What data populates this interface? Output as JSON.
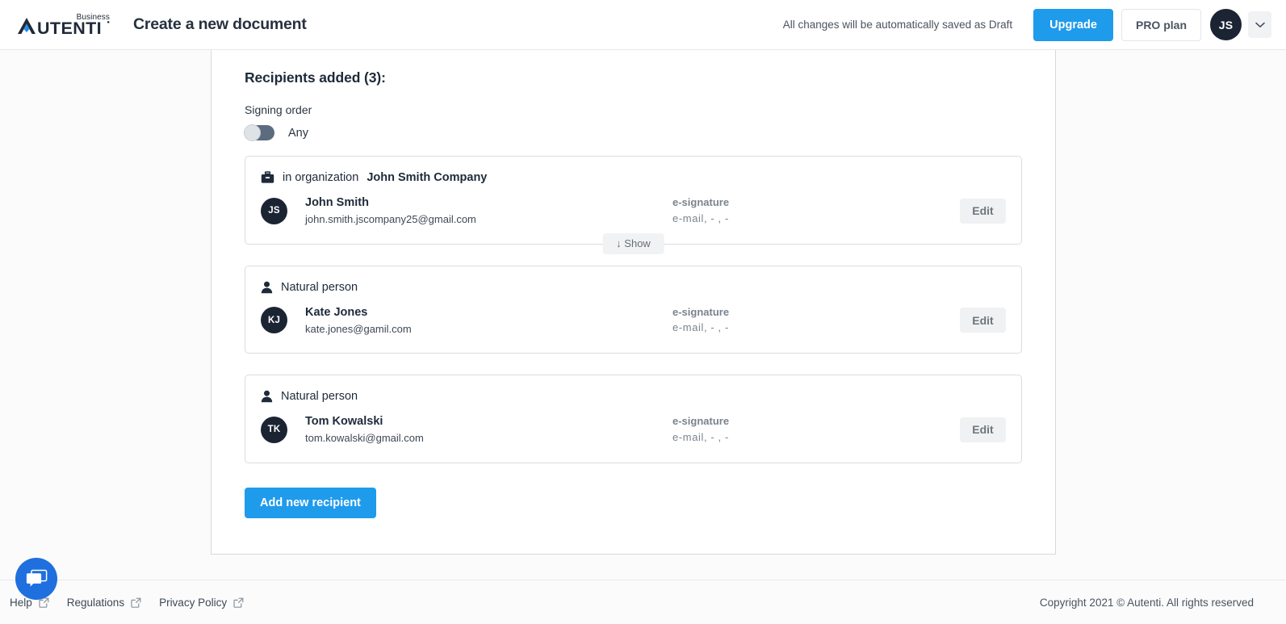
{
  "header": {
    "logo_text": "AUTENTI",
    "logo_super": "Business",
    "page_title": "Create a new document",
    "autosave_note": "All changes will be automatically saved as Draft",
    "upgrade_label": "Upgrade",
    "plan_label": "PRO plan",
    "avatar_initials": "JS",
    "accent_color": "#1f9bec",
    "avatar_color": "#1b2433"
  },
  "main": {
    "recipients_title": "Recipients added (3):",
    "signing_order_label": "Signing order",
    "signing_order_value": "Any",
    "signing_order_on": false,
    "show_label": "↓ Show",
    "add_recipient_label": "Add new recipient",
    "edit_label": "Edit",
    "recipients": [
      {
        "type_prefix": "in organization",
        "type_label": "John Smith Company",
        "type_icon": "briefcase-icon",
        "initials": "JS",
        "name": "John Smith",
        "email": "john.smith.jscompany25@gmail.com",
        "signature_type": "e-signature",
        "delivery": "e-mail,  -  ,  -",
        "edit_label": "Edit",
        "has_show": true
      },
      {
        "type_prefix": "",
        "type_label": "Natural person",
        "type_icon": "person-icon",
        "initials": "KJ",
        "name": "Kate Jones",
        "email": "kate.jones@gamil.com",
        "signature_type": "e-signature",
        "delivery": "e-mail,  -  ,  -",
        "edit_label": "Edit",
        "has_show": false
      },
      {
        "type_prefix": "",
        "type_label": "Natural person",
        "type_icon": "person-icon",
        "initials": "TK",
        "name": "Tom Kowalski",
        "email": "tom.kowalski@gmail.com",
        "signature_type": "e-signature",
        "delivery": "e-mail,  -  ,  -",
        "edit_label": "Edit",
        "has_show": false
      }
    ]
  },
  "footer": {
    "links": [
      {
        "label": "Help",
        "icon": "external-link-icon"
      },
      {
        "label": "Regulations",
        "icon": "external-link-icon"
      },
      {
        "label": "Privacy Policy",
        "icon": "external-link-icon"
      }
    ],
    "copyright": "Copyright 2021 © Autenti. All rights reserved",
    "chat_icon": "chat-bubble-icon"
  }
}
